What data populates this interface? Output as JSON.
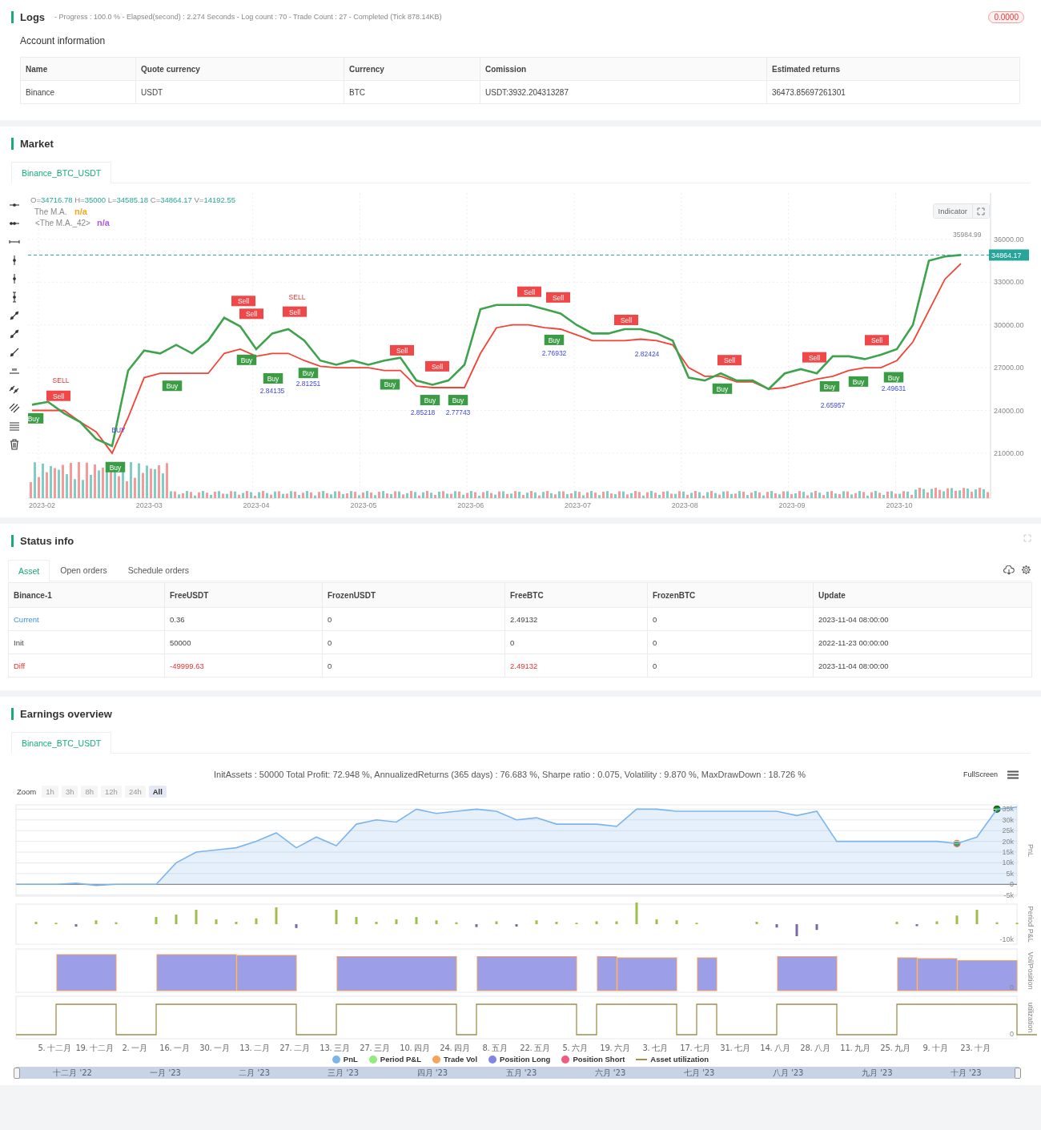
{
  "logs": {
    "title": "Logs",
    "summary": "- Progress : 100.0 % - Elapsed(second) : 2.274  Seconds - Log count : 70 - Trade Count : 27 - Completed (Tick 878.14KB)",
    "badge": "0.0000"
  },
  "account": {
    "title": "Account information",
    "columns": [
      "Name",
      "Quote currency",
      "Currency",
      "Comission",
      "Estimated returns"
    ],
    "rows": [
      [
        "Binance",
        "USDT",
        "BTC",
        "USDT:3932.204313287",
        "36473.85697261301"
      ]
    ]
  },
  "market": {
    "title": "Market",
    "tabs": [
      {
        "label": "Binance_BTC_USDT",
        "selected": true
      }
    ],
    "ohlc": [
      {
        "label": "O=",
        "value": "34716.78"
      },
      {
        "label": "H=",
        "value": "35000"
      },
      {
        "label": "L=",
        "value": "34585.18"
      },
      {
        "label": "C=",
        "value": "34864.17"
      },
      {
        "label": "V=",
        "value": "14192.55"
      }
    ],
    "indicators": [
      {
        "name": "The M.A.",
        "value": "n/a",
        "color": "#f5a623"
      },
      {
        "name": "<The M.A._42>",
        "value": "n/a",
        "color": "#b15be3"
      }
    ],
    "indicator_button": "Indicator",
    "high_label": "35984.99",
    "price_tag": "34864.17",
    "chart_data": {
      "type": "line",
      "grid": true,
      "ylim": [
        17850,
        39250
      ],
      "yticks": [
        {
          "value": 21000,
          "label": "21000.00"
        },
        {
          "value": 24000,
          "label": "24000.00"
        },
        {
          "value": 27000,
          "label": "27000.00"
        },
        {
          "value": 30000,
          "label": "30000.00"
        },
        {
          "value": 33000,
          "label": "33000.00"
        },
        {
          "value": 36000,
          "label": "36000.00"
        }
      ],
      "series": [
        {
          "color": "#3fa34d",
          "values": [
            24400,
            24600,
            23800,
            23200,
            22000,
            21500,
            26800,
            28200,
            28000,
            28600,
            28000,
            28900,
            30500,
            29900,
            28300,
            29400,
            29700,
            28900,
            27500,
            27200,
            27500,
            27200,
            27500,
            27700,
            26100,
            25800,
            26100,
            27200,
            31100,
            31400,
            31400,
            31400,
            31100,
            30800,
            30000,
            29400,
            29400,
            29700,
            29700,
            29400,
            28900,
            26300,
            26100,
            26600,
            26100,
            26100,
            25500,
            26600,
            26900,
            26600,
            27800,
            27800,
            27600,
            27900,
            28300,
            30000,
            34500,
            34800,
            34900
          ]
        },
        {
          "color": "#f44336",
          "values": [
            24000,
            24000,
            24000,
            23200,
            22500,
            21000,
            23500,
            26300,
            26600,
            26600,
            26600,
            26600,
            28000,
            28300,
            27800,
            28000,
            28000,
            27500,
            27100,
            27000,
            27000,
            27000,
            26800,
            26800,
            25700,
            25600,
            25600,
            25600,
            28000,
            29800,
            30000,
            30000,
            29800,
            29700,
            29300,
            28900,
            28900,
            28900,
            29000,
            28900,
            28600,
            27000,
            26400,
            26400,
            26000,
            26000,
            25500,
            25600,
            25900,
            26200,
            26400,
            26800,
            27000,
            27000,
            27500,
            28800,
            31000,
            33200,
            34300
          ]
        }
      ]
    },
    "x_axis_labels": [
      "2023-02",
      "2023-03",
      "2023-04",
      "2023-05",
      "2023-06",
      "2023-07",
      "2023-08",
      "2023-09",
      "2023-10"
    ],
    "trade_markers": [
      {
        "kind": "buy",
        "text": "Buy"
      },
      {
        "kind": "sell_note",
        "text": "SELL"
      },
      {
        "kind": "sell",
        "text": "Sell"
      },
      {
        "kind": "buy_note",
        "text": "BUY"
      },
      {
        "kind": "buy",
        "text": "Buy"
      },
      {
        "kind": "buy",
        "text": "Buy"
      },
      {
        "kind": "sell",
        "text": "Sell"
      },
      {
        "kind": "sell",
        "text": "Sell"
      },
      {
        "kind": "buy",
        "text": "Buy"
      },
      {
        "kind": "buy",
        "text": "Buy"
      },
      {
        "kind": "value",
        "text": "2.84135"
      },
      {
        "kind": "sell_note",
        "text": "SELL"
      },
      {
        "kind": "sell",
        "text": "Sell"
      },
      {
        "kind": "buy",
        "text": "Buy"
      },
      {
        "kind": "value",
        "text": "2.81251"
      },
      {
        "kind": "buy",
        "text": "Buy"
      },
      {
        "kind": "sell",
        "text": "Sell"
      },
      {
        "kind": "sell",
        "text": "Sell"
      },
      {
        "kind": "buy",
        "text": "Buy"
      },
      {
        "kind": "value",
        "text": "2.85218"
      },
      {
        "kind": "buy",
        "text": "Buy"
      },
      {
        "kind": "value",
        "text": "2.77743"
      },
      {
        "kind": "sell",
        "text": "Sell"
      },
      {
        "kind": "sell",
        "text": "Sell"
      },
      {
        "kind": "buy",
        "text": "Buy"
      },
      {
        "kind": "value",
        "text": "2.76932"
      },
      {
        "kind": "sell",
        "text": "Sell"
      },
      {
        "kind": "value",
        "text": "2.82424"
      },
      {
        "kind": "buy",
        "text": "Buy"
      },
      {
        "kind": "sell",
        "text": "Sell"
      },
      {
        "kind": "sell",
        "text": "Sell"
      },
      {
        "kind": "buy",
        "text": "Buy"
      },
      {
        "kind": "value",
        "text": "2.65957"
      },
      {
        "kind": "buy",
        "text": "Buy"
      },
      {
        "kind": "sell",
        "text": "Sell"
      },
      {
        "kind": "buy",
        "text": "Buy"
      },
      {
        "kind": "value",
        "text": "2.49631"
      }
    ]
  },
  "status": {
    "title": "Status info",
    "tabs": [
      {
        "label": "Asset",
        "selected": true
      },
      {
        "label": "Open orders",
        "selected": false
      },
      {
        "label": "Schedule orders",
        "selected": false
      }
    ],
    "columns": [
      "Binance-1",
      "FreeUSDT",
      "FrozenUSDT",
      "FreeBTC",
      "FrozenBTC",
      "Update"
    ],
    "rows": [
      {
        "kind": "current",
        "cells": [
          {
            "text": "Current",
            "changed": false
          },
          {
            "text": "0.36",
            "changed": false
          },
          {
            "text": "0",
            "changed": false
          },
          {
            "text": "2.49132",
            "changed": false
          },
          {
            "text": "0",
            "changed": false
          },
          {
            "text": "2023-11-04 08:00:00",
            "changed": false
          }
        ]
      },
      {
        "kind": "init",
        "cells": [
          {
            "text": "Init",
            "changed": false
          },
          {
            "text": "50000",
            "changed": false
          },
          {
            "text": "0",
            "changed": false
          },
          {
            "text": "0",
            "changed": false
          },
          {
            "text": "0",
            "changed": false
          },
          {
            "text": "2022-11-23 00:00:00",
            "changed": false
          }
        ]
      },
      {
        "kind": "diff",
        "cells": [
          {
            "text": "Diff",
            "changed": true
          },
          {
            "text": "-49999.63",
            "changed": true
          },
          {
            "text": "0",
            "changed": false
          },
          {
            "text": "2.49132",
            "changed": true
          },
          {
            "text": "0",
            "changed": false
          },
          {
            "text": "2023-11-04 08:00:00",
            "changed": false
          }
        ]
      }
    ]
  },
  "earnings": {
    "title": "Earnings overview",
    "tabs": [
      {
        "label": "Binance_BTC_USDT",
        "selected": true
      }
    ],
    "summary": "InitAssets : 50000 Total Profit: 72.948 %, AnnualizedReturns (365 days) : 76.683 %, Sharpe ratio : 0.075, Volatility : 9.870 %, MaxDrawDown : 18.726 %",
    "fullscreen": "FullScreen",
    "zoom_label": "Zoom",
    "zoom_buttons": [
      {
        "label": "1h",
        "selected": false,
        "disabled": true
      },
      {
        "label": "3h",
        "selected": false,
        "disabled": true
      },
      {
        "label": "8h",
        "selected": false,
        "disabled": true
      },
      {
        "label": "12h",
        "selected": false,
        "disabled": true
      },
      {
        "label": "24h",
        "selected": false,
        "disabled": true
      },
      {
        "label": "All",
        "selected": true,
        "disabled": false
      }
    ],
    "pnl_chart": {
      "chart_data": {
        "type": "area",
        "grid": true,
        "ylabel": "PnL",
        "ylim": [
          -5.5,
          37
        ],
        "yticks": [
          {
            "value": -5,
            "label": "-5k"
          },
          {
            "value": 0,
            "label": "0"
          },
          {
            "value": 5,
            "label": "5k"
          },
          {
            "value": 10,
            "label": "10k"
          },
          {
            "value": 15,
            "label": "15k"
          },
          {
            "value": 20,
            "label": "20k"
          },
          {
            "value": 25,
            "label": "25k"
          },
          {
            "value": 30,
            "label": "30k"
          },
          {
            "value": 35,
            "label": "35k"
          }
        ],
        "series": [
          {
            "color": "#7cb5ec",
            "values": [
              0,
              0,
              0,
              0.5,
              -0.5,
              0,
              0,
              0,
              10,
              15,
              16,
              17,
              20,
              24,
              17,
              22,
              18,
              28,
              30,
              29,
              35,
              33,
              34,
              35,
              34,
              30,
              31,
              28,
              28,
              28,
              27,
              35,
              35,
              34,
              34,
              34,
              34,
              34,
              34,
              32,
              34,
              20,
              20,
              20,
              20,
              20,
              20,
              19,
              22,
              35,
              36
            ]
          }
        ]
      }
    },
    "subpanels": [
      {
        "kind": "pnl_bars",
        "label": "Period P&L",
        "tick": "-10k"
      },
      {
        "kind": "position_blocks",
        "label": "Vol/Position",
        "tick": "0"
      },
      {
        "kind": "step_line",
        "label": "utilization",
        "tick": "0"
      }
    ],
    "x_axis_labels": [
      "5. 十二月",
      "19. 十二月",
      "2. 一月",
      "16. 一月",
      "30. 一月",
      "13. 二月",
      "27. 二月",
      "13. 三月",
      "27. 三月",
      "10. 四月",
      "24. 四月",
      "8. 五月",
      "22. 五月",
      "5. 六月",
      "19. 六月",
      "3. 七月",
      "17. 七月",
      "31. 七月",
      "14. 八月",
      "28. 八月",
      "11. 九月",
      "25. 九月",
      "9. 十月",
      "23. 十月"
    ],
    "legend": [
      {
        "name": "PnL",
        "color": "#7cb5ec",
        "kind": "dot"
      },
      {
        "name": "Period P&L",
        "color": "#90ed7d",
        "kind": "dot"
      },
      {
        "name": "Trade Vol",
        "color": "#f7a35c",
        "kind": "dot"
      },
      {
        "name": "Position Long",
        "color": "#8085e9",
        "kind": "dot"
      },
      {
        "name": "Position Short",
        "color": "#f15c80",
        "kind": "dot"
      },
      {
        "name": "Asset utilization",
        "color": "#a08f4f",
        "kind": "line"
      }
    ],
    "navigator": [
      "十二月 '22",
      "一月 '23",
      "二月 '23",
      "三月 '23",
      "四月 '23",
      "五月 '23",
      "六月 '23",
      "七月 '23",
      "八月 '23",
      "九月 '23",
      "十月 '23"
    ]
  }
}
